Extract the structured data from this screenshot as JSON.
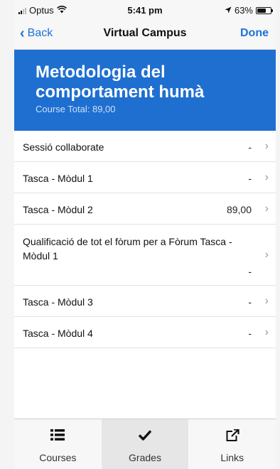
{
  "status_bar": {
    "carrier": "Optus",
    "time": "5:41 pm",
    "battery": "63%"
  },
  "nav": {
    "back_label": "Back",
    "title": "Virtual Campus",
    "done_label": "Done"
  },
  "course": {
    "title": "Metodologia del comportament humà",
    "total": "Course Total: 89,00"
  },
  "grades": [
    {
      "label": "Sessió collaborate",
      "value": "-"
    },
    {
      "label": "Tasca - Mòdul 1",
      "value": "-"
    },
    {
      "label": "Tasca - Mòdul 2",
      "value": "89,00"
    },
    {
      "label": "Qualificació de tot el fòrum per a Fòrum Tasca - Mòdul 1",
      "value": "-"
    },
    {
      "label": "Tasca - Mòdul 3",
      "value": "-"
    },
    {
      "label": "Tasca - Mòdul 4",
      "value": "-"
    }
  ],
  "tabs": [
    {
      "label": "Courses",
      "icon": "list-icon"
    },
    {
      "label": "Grades",
      "icon": "checkmark-icon"
    },
    {
      "label": "Links",
      "icon": "external-link-icon"
    }
  ],
  "colors": {
    "header_bg": "#1e6fd0",
    "link_blue": "#1a73d9"
  }
}
